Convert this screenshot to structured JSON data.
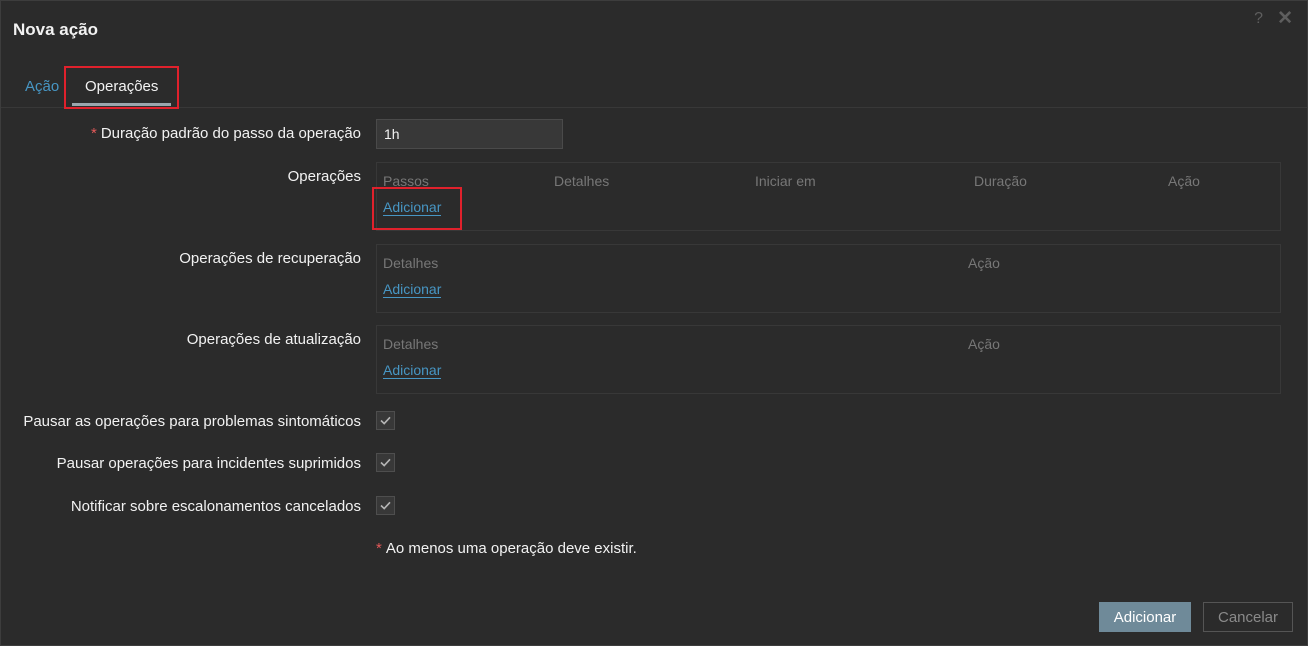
{
  "dialog": {
    "title": "Nova ação",
    "help_icon": "help-icon",
    "close_icon": "close-icon"
  },
  "tabs": [
    {
      "label": "Ação",
      "active": false
    },
    {
      "label": "Operações",
      "active": true
    }
  ],
  "form": {
    "step_duration": {
      "label": "Duração padrão do passo da operação",
      "required": true,
      "value": "1h"
    },
    "operations": {
      "label": "Operações",
      "columns": [
        "Passos",
        "Detalhes",
        "Iniciar em",
        "Duração",
        "Ação"
      ],
      "add_link": "Adicionar"
    },
    "recovery_operations": {
      "label": "Operações de recuperação",
      "columns": [
        "Detalhes",
        "Ação"
      ],
      "add_link": "Adicionar"
    },
    "update_operations": {
      "label": "Operações de atualização",
      "columns": [
        "Detalhes",
        "Ação"
      ],
      "add_link": "Adicionar"
    },
    "pause_symptoms": {
      "label": "Pausar as operações para problemas sintomáticos",
      "checked": true
    },
    "pause_suppressed": {
      "label": "Pausar operações para incidentes suprimidos",
      "checked": true
    },
    "notify_canceled": {
      "label": "Notificar sobre escalonamentos cancelados",
      "checked": true
    },
    "note": {
      "asterisk": "*",
      "text": "Ao menos uma operação deve existir."
    }
  },
  "buttons": {
    "add": "Adicionar",
    "cancel": "Cancelar"
  },
  "colors": {
    "background": "#2b2b2b",
    "link": "#4796c4",
    "highlight": "#e0212c",
    "primary_button": "#6f8a99",
    "required": "#e45959"
  }
}
